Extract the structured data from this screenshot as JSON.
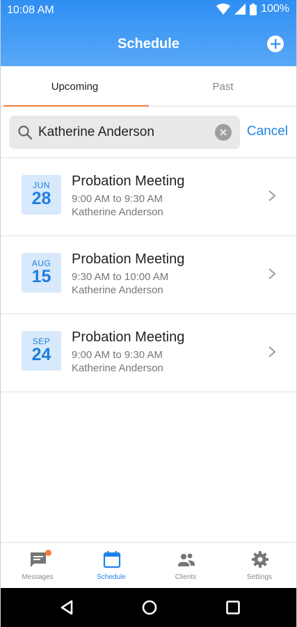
{
  "status_bar": {
    "time": "10:08 AM",
    "battery": "100%"
  },
  "header": {
    "title": "Schedule"
  },
  "tabs": [
    {
      "label": "Upcoming",
      "active": true
    },
    {
      "label": "Past",
      "active": false
    }
  ],
  "search": {
    "value": "Katherine Anderson",
    "cancel_label": "Cancel"
  },
  "appointments": [
    {
      "month": "JUN",
      "day": "28",
      "title": "Probation Meeting",
      "time": "9:00 AM to 9:30 AM",
      "client": "Katherine Anderson"
    },
    {
      "month": "AUG",
      "day": "15",
      "title": "Probation Meeting",
      "time": "9:30 AM to 10:00 AM",
      "client": "Katherine Anderson"
    },
    {
      "month": "SEP",
      "day": "24",
      "title": "Probation Meeting",
      "time": "9:00 AM to 9:30 AM",
      "client": "Katherine Anderson"
    }
  ],
  "bottom_nav": [
    {
      "label": "Messages",
      "icon": "messages-icon",
      "badge": true
    },
    {
      "label": "Schedule",
      "icon": "calendar-icon",
      "active": true
    },
    {
      "label": "Clients",
      "icon": "people-icon"
    },
    {
      "label": "Settings",
      "icon": "gear-icon"
    }
  ],
  "colors": {
    "accent": "#1f84e8",
    "header_top": "#2f8ef3",
    "header_bottom": "#58a8f7",
    "tab_indicator": "#f47b3b",
    "date_badge_bg": "#d7e9fb"
  }
}
